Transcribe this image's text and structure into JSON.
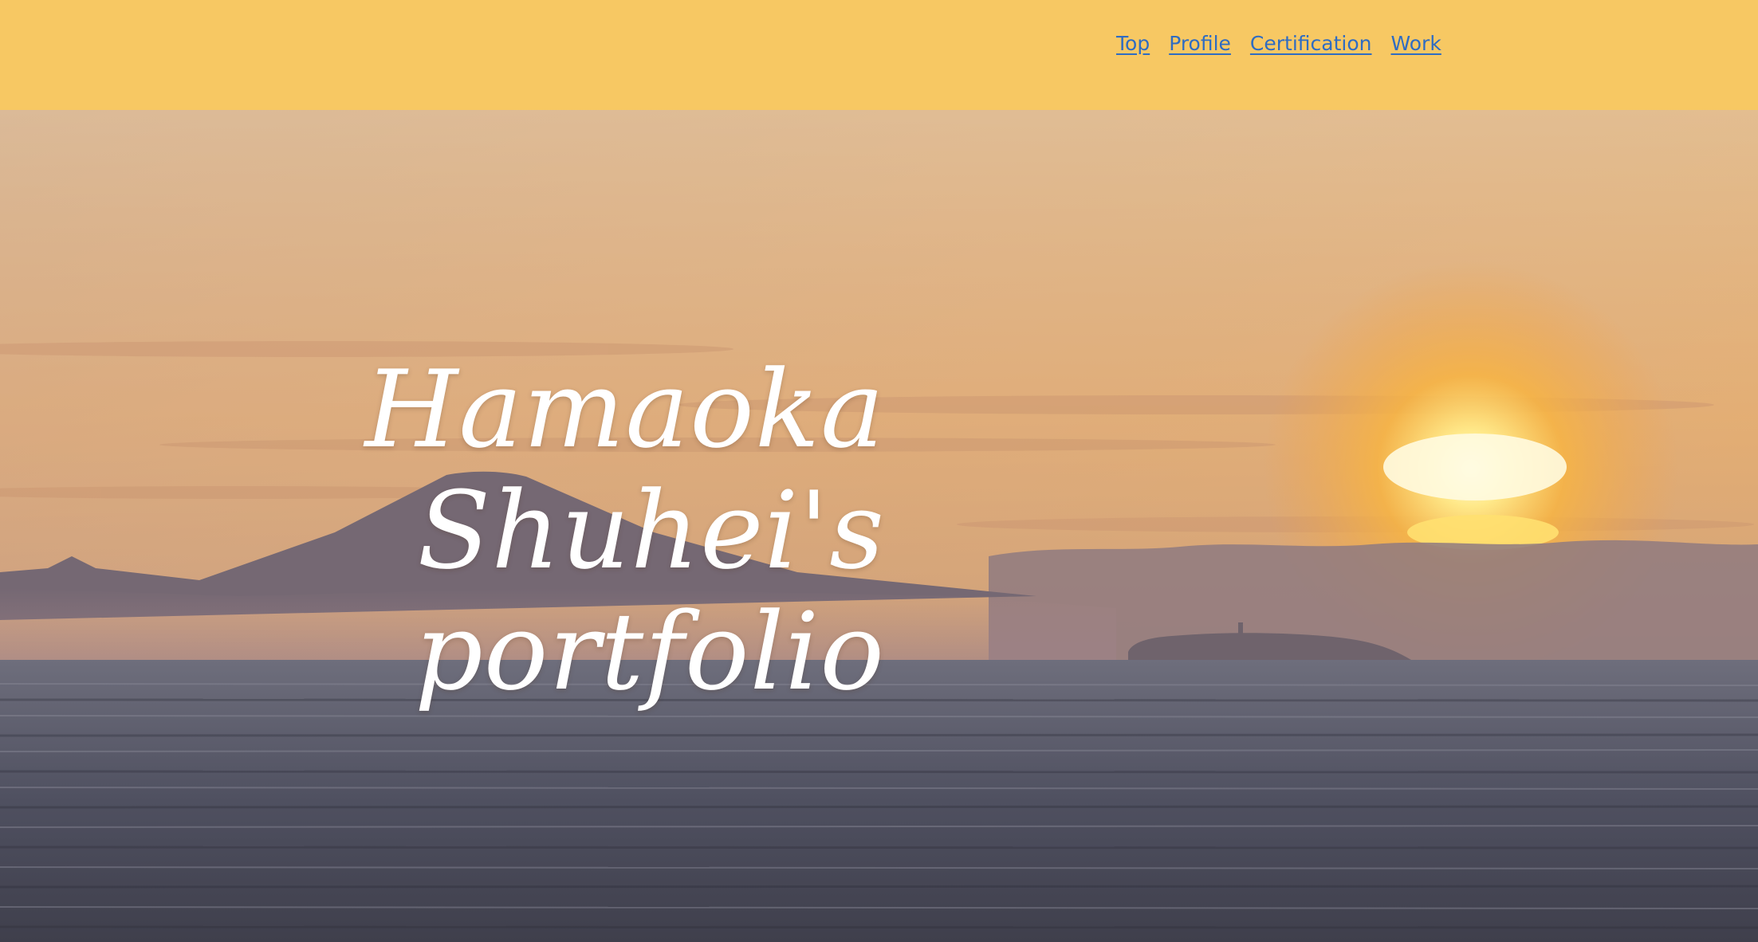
{
  "nav": {
    "items": [
      {
        "label": "Top"
      },
      {
        "label": "Profile"
      },
      {
        "label": "Certification"
      },
      {
        "label": "Work"
      }
    ]
  },
  "hero": {
    "title_line1": "Hamaoka Shuhei's",
    "title_line2": "portfolio",
    "image": "sunset over sea with mountain and island"
  },
  "colors": {
    "header_bg": "#f7c863",
    "nav_link": "#2f6cc2",
    "title_text": "#ffffff"
  }
}
